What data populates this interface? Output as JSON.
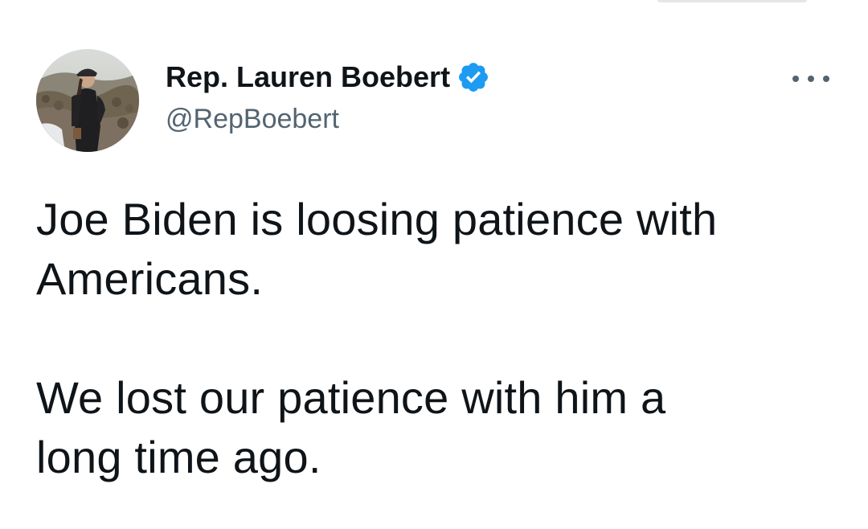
{
  "author": {
    "display_name": "Rep. Lauren Boebert",
    "handle": "@RepBoebert",
    "verified": true,
    "verified_icon": "verified-badge-icon",
    "avatar_icon": "profile-photo"
  },
  "tweet": {
    "paragraphs": [
      "Joe Biden is loosing patience with\nAmericans.",
      "We lost our patience with him a\nlong time ago."
    ]
  },
  "menu": {
    "icon": "more-options-icon"
  },
  "colors": {
    "text_primary": "#0f1419",
    "text_secondary": "#536471",
    "verified_blue": "#1d9bf0",
    "background": "#ffffff"
  }
}
